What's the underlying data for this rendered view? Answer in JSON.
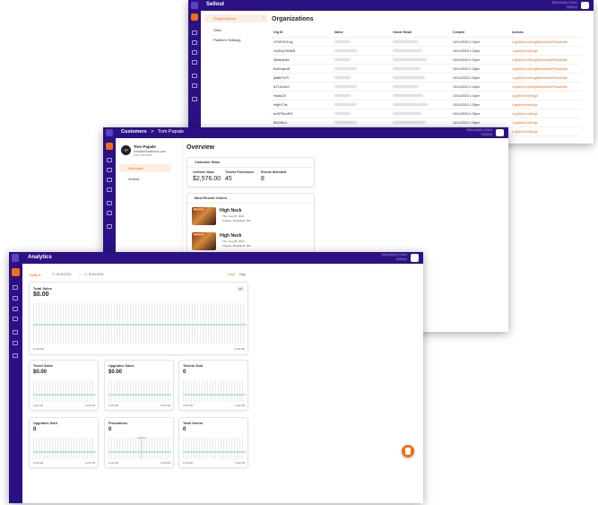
{
  "organizations_window": {
    "app_title": "Sellout",
    "user_name": "Mercedes Chen",
    "user_sub": "Sellout",
    "nav": [
      {
        "label": "Organizations",
        "active": true
      },
      {
        "label": "Sites",
        "active": false
      },
      {
        "label": "Platform Settings",
        "active": false
      }
    ],
    "page_title": "Organizations",
    "columns": [
      "Org ID",
      "Name",
      "Owner Email",
      "Created",
      "Actions"
    ],
    "rows": [
      {
        "id": "HTMFKXZrcg",
        "created": "10/14/2020 1:12pm",
        "actions": [
          "Login",
          "View settings",
          "Deactivate/Reactivate"
        ]
      },
      {
        "id": "04UBvyTdNMD",
        "created": "10/14/2020 1:13pm",
        "actions": [
          "Login",
          "View settings"
        ]
      },
      {
        "id": "9jb9leqN6s",
        "created": "10/14/2020 1:13pm",
        "actions": [
          "Login",
          "View settings",
          "Deactivate/Reactivate"
        ]
      },
      {
        "id": "Bz60ngzhB",
        "created": "10/14/2020 1:13pm",
        "actions": [
          "Login",
          "View settings",
          "Deactivate/Reactivate"
        ]
      },
      {
        "id": "j6k8bF4rPl",
        "created": "10/14/2020 1:14pm",
        "actions": [
          "Login",
          "View settings",
          "Deactivate/Reactivate"
        ]
      },
      {
        "id": "lsT1Gu4eO",
        "created": "10/14/2020 1:14pm",
        "actions": [
          "Login",
          "View settings",
          "Deactivate/Reactivate"
        ]
      },
      {
        "id": "HwdbZ2l",
        "created": "10/14/2020 1:14pm",
        "actions": [
          "Login",
          "View settings"
        ]
      },
      {
        "id": "rhtgfYChk",
        "created": "10/14/2020 1:15pm",
        "actions": [
          "Login",
          "View settings"
        ]
      },
      {
        "id": "bzGFNkmRr8",
        "created": "10/14/2020 1:15pm",
        "actions": [
          "Login",
          "View settings"
        ]
      },
      {
        "id": "B9iZ6Bo1",
        "created": "10/14/2020 1:15pm",
        "actions": [
          "Login",
          "View settings"
        ]
      },
      {
        "id": "Ntld9lG4",
        "created": "10/14/2020 1:16pm",
        "actions": [
          "Login",
          "View settings"
        ]
      }
    ]
  },
  "customer_window": {
    "breadcrumb_root": "Customers",
    "breadcrumb_sep": ">",
    "breadcrumb_current": "Tom Papale",
    "user_name": "Mercedes Chen",
    "user_sub": "Sellout",
    "customer_initials": "TP",
    "customer_name": "Tom Papale",
    "customer_email": "tom@selloutmusic.com",
    "customer_phone": "(555) 555-5555",
    "nav": [
      {
        "label": "Overview",
        "active": true
      },
      {
        "label": "Orders",
        "active": false
      }
    ],
    "page_title": "Overview",
    "stats_title": "Customer Stats",
    "stats": [
      {
        "label": "Lifetime Value",
        "value": "$2,576.00"
      },
      {
        "label": "Tickets Purchased",
        "value": "45"
      },
      {
        "label": "Events Attended",
        "value": "8"
      }
    ],
    "orders_title": "Most Recent Orders",
    "orders": [
      {
        "event": "High Neck",
        "date": "Thu, Aug 26, 2021",
        "venue": "Chaotic, Brookfield, MO",
        "badge": "Upcoming"
      },
      {
        "event": "High Neck",
        "date": "Thu, Aug 26, 2021",
        "venue": "Chaotic, Brookfield, MO",
        "badge": "Upcoming"
      }
    ]
  },
  "analytics_window": {
    "app_title": "Analytics",
    "user_name": "Mercedes Chen",
    "user_sub": "Sellout",
    "range_label": "Today",
    "date_from": "6/19/2021",
    "arrow": "→",
    "date_to": "6/19/2021",
    "granularity": [
      "Hour",
      "Day"
    ],
    "main_card": {
      "title": "Total Sales",
      "value": "$0.00",
      "badge": "$0"
    },
    "axis_left": "12:00 AM",
    "axis_right": "11:00 PM",
    "small_cards": [
      {
        "title": "Ticket Sales",
        "value": "$0.00"
      },
      {
        "title": "Upgrades Sales",
        "value": "$0.00"
      },
      {
        "title": "Tickets Sold",
        "value": "0"
      },
      {
        "title": "Upgrades Sold",
        "value": "0"
      },
      {
        "title": "Promotions",
        "value": "0",
        "annotation": "1 Album"
      },
      {
        "title": "Total Orders",
        "value": "0"
      }
    ]
  },
  "colors": {
    "brand_purple": "#2b1183",
    "accent_orange": "#f36b12",
    "chart_line": "#b9e7dc"
  }
}
